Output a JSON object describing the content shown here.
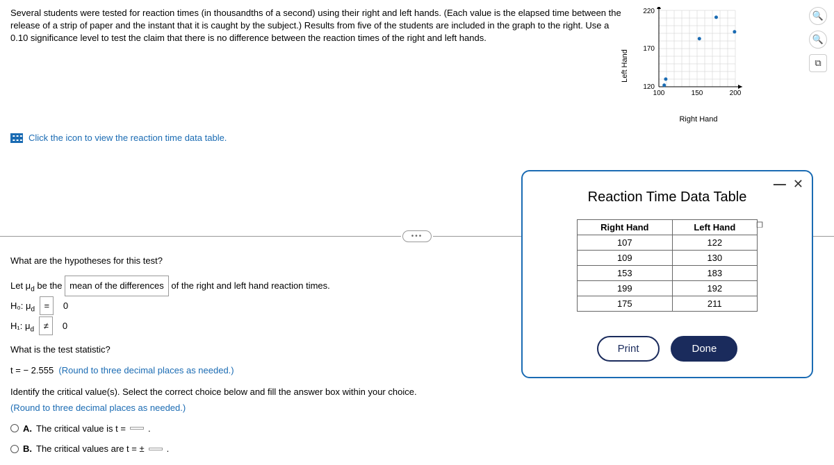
{
  "question": {
    "intro": "Several students were tested for reaction times (in thousandths of a second) using their right and left hands. (Each value is the elapsed time between the release of a strip of paper and the instant that it is caught by the subject.) Results from five of the students are included in the graph to the right. Use a 0.10 significance level to test the claim that there is no difference between the reaction times of the right and left hands.",
    "data_link": "Click the icon to view the reaction time data table."
  },
  "prompts": {
    "hypotheses_q": "What are the hypotheses for this test?",
    "let_line_prefix": "Let μ",
    "let_line_sub": "d",
    "let_line_mid": " be the ",
    "dropdown1": "mean of the differences",
    "let_line_suffix": " of the right and left hand reaction times.",
    "h0_label": "H₀: μ",
    "h0_op": "=",
    "h0_val": "0",
    "h1_label": "H₁: μ",
    "h1_op": "≠",
    "h1_val": "0",
    "test_stat_q": "What is the test statistic?",
    "t_prefix": "t = ",
    "t_value": "− 2.555",
    "t_note": "(Round to three decimal places as needed.)",
    "crit_q": "Identify the critical value(s). Select the correct choice below and fill the answer box within your choice.",
    "crit_note": "(Round to three decimal places as needed.)",
    "choice_a_label": "A.",
    "choice_a_text": "The critical value is t = ",
    "choice_a_suffix": ".",
    "choice_b_label": "B.",
    "choice_b_text": "The critical values are t = ± ",
    "choice_b_suffix": "."
  },
  "modal": {
    "title": "Reaction Time Data Table",
    "headers": {
      "right": "Right Hand",
      "left": "Left Hand"
    },
    "rows": [
      {
        "right": "107",
        "left": "122"
      },
      {
        "right": "109",
        "left": "130"
      },
      {
        "right": "153",
        "left": "183"
      },
      {
        "right": "199",
        "left": "192"
      },
      {
        "right": "175",
        "left": "211"
      }
    ],
    "print": "Print",
    "done": "Done"
  },
  "chart_data": {
    "type": "scatter",
    "xlabel": "Right Hand",
    "ylabel": "Left Hand",
    "xlim": [
      100,
      200
    ],
    "ylim": [
      120,
      220
    ],
    "xticks": [
      "100",
      "150",
      "200"
    ],
    "yticks": [
      "120",
      "170",
      "220"
    ],
    "points": [
      {
        "x": 107,
        "y": 122
      },
      {
        "x": 109,
        "y": 130
      },
      {
        "x": 153,
        "y": 183
      },
      {
        "x": 199,
        "y": 192
      },
      {
        "x": 175,
        "y": 211
      }
    ]
  }
}
